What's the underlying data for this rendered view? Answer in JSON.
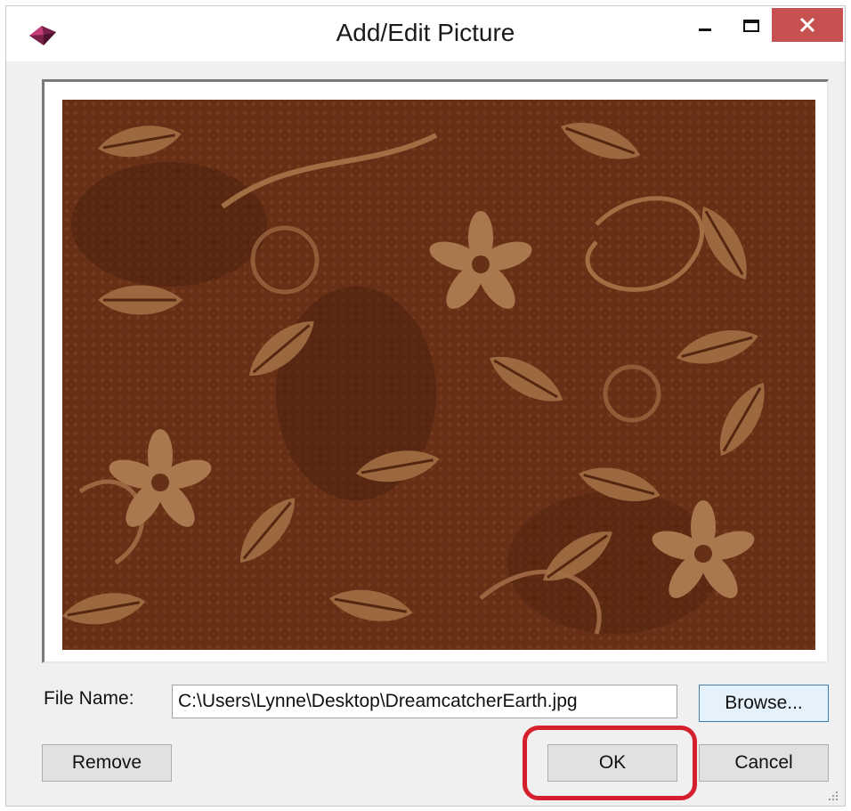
{
  "window": {
    "title": "Add/Edit Picture",
    "icons": {
      "app": "app-icon",
      "minimize": "minimize-icon",
      "maximize": "maximize-icon",
      "close": "close-icon"
    },
    "close_color": "#c75050"
  },
  "preview": {
    "image": "brown batik fabric floral pattern"
  },
  "file": {
    "label": "File Name:",
    "value": "C:\\Users\\Lynne\\Desktop\\DreamcatcherEarth.jpg"
  },
  "buttons": {
    "browse": "Browse...",
    "remove": "Remove",
    "ok": "OK",
    "cancel": "Cancel"
  },
  "annotation_color": "#d4202c"
}
